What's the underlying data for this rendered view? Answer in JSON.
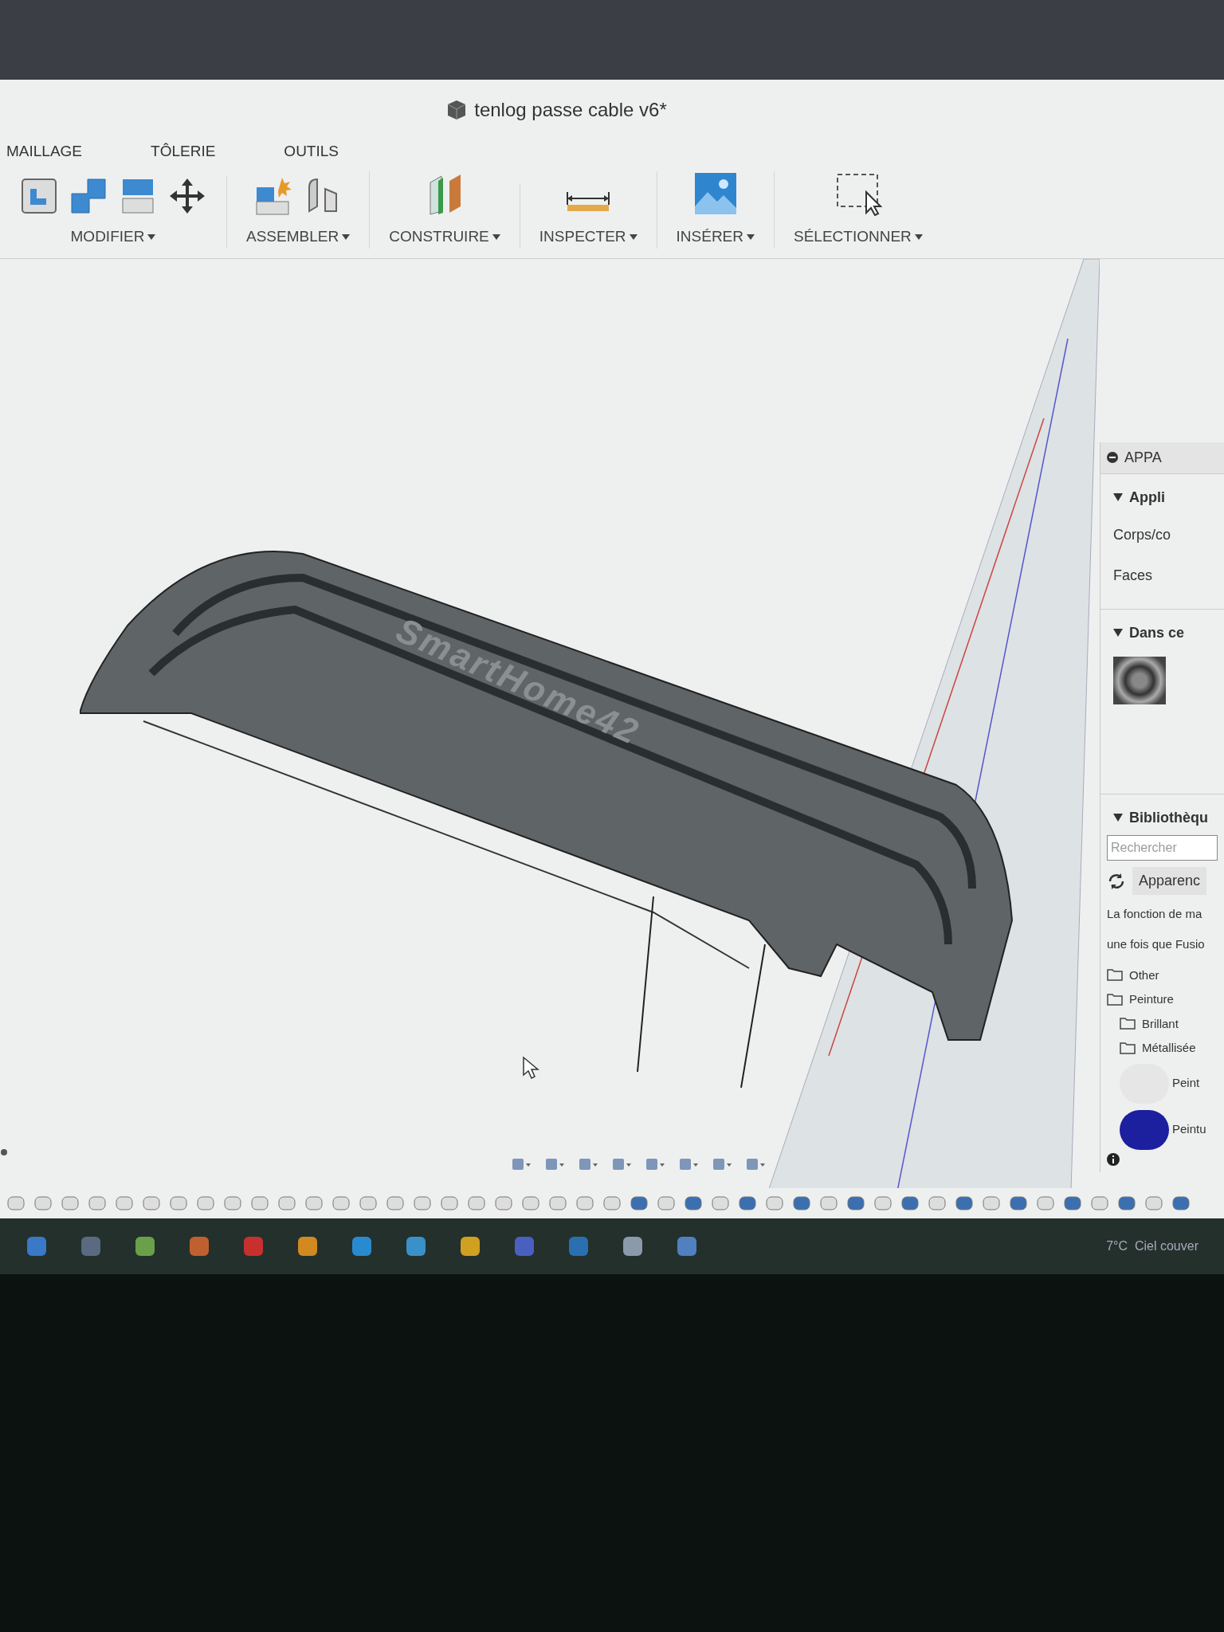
{
  "window": {
    "title": "tenlog passe cable v6*"
  },
  "toolbar": {
    "tabs": [
      {
        "label": "MAILLAGE"
      },
      {
        "label": "TÔLERIE"
      },
      {
        "label": "OUTILS"
      }
    ],
    "groups": [
      {
        "label": "MODIFIER",
        "kind": "modify"
      },
      {
        "label": "ASSEMBLER",
        "kind": "assemble"
      },
      {
        "label": "CONSTRUIRE",
        "kind": "construct"
      },
      {
        "label": "INSPECTER",
        "kind": "inspect"
      },
      {
        "label": "INSÉRER",
        "kind": "insert"
      },
      {
        "label": "SÉLECTIONNER",
        "kind": "select"
      }
    ]
  },
  "viewport": {
    "model_text": "SmartHome42"
  },
  "appearance_panel": {
    "title": "APPA",
    "sections": [
      {
        "title": "Appli",
        "expanded": true,
        "items": [
          "Corps/co",
          "Faces"
        ]
      },
      {
        "title": "Dans ce",
        "expanded": true
      }
    ],
    "library": {
      "title": "Bibliothèqu",
      "expanded": true,
      "search": {
        "placeholder": "Rechercher"
      },
      "source": "Apparenc",
      "notice": [
        "La fonction de ma",
        "une fois que Fusio"
      ],
      "tree": [
        {
          "label": "Other"
        },
        {
          "label": "Peinture",
          "children": [
            {
              "label": "Brillant"
            },
            {
              "label": "Métallisée"
            }
          ]
        }
      ],
      "materials": [
        {
          "label": "Peint",
          "color": "#e6e6e6"
        },
        {
          "label": "Peintu",
          "color": "#1c1f9e"
        }
      ]
    }
  },
  "taskbar": {
    "weather": "7°C  Ciel couver"
  }
}
